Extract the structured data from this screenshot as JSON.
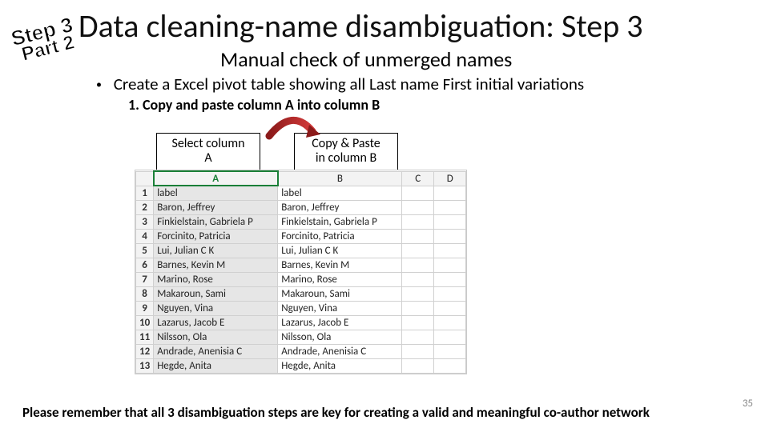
{
  "stamp": {
    "line1": "Step 3",
    "line2": "Part 2"
  },
  "title": "Data cleaning-name disambiguation: Step 3",
  "subtitle": "Manual check of unmerged names",
  "bullet": "Create a Excel pivot table showing all Last name First initial variations",
  "substep": "1. Copy and paste column A into column B",
  "labelA": {
    "l1": "Select column",
    "l2": "A"
  },
  "labelB": {
    "l1": "Copy & Paste",
    "l2": "in column B"
  },
  "sheet": {
    "cols": [
      "A",
      "B",
      "C",
      "D"
    ],
    "rows": [
      {
        "n": "1",
        "a": "label",
        "b": "label"
      },
      {
        "n": "2",
        "a": "Baron, Jeffrey",
        "b": "Baron, Jeffrey"
      },
      {
        "n": "3",
        "a": "Finkielstain, Gabriela P",
        "b": "Finkielstain, Gabriela P"
      },
      {
        "n": "4",
        "a": "Forcinito, Patricia",
        "b": "Forcinito, Patricia"
      },
      {
        "n": "5",
        "a": "Lui, Julian C K",
        "b": "Lui, Julian C K"
      },
      {
        "n": "6",
        "a": "Barnes, Kevin M",
        "b": "Barnes, Kevin M"
      },
      {
        "n": "7",
        "a": "Marino, Rose",
        "b": "Marino, Rose"
      },
      {
        "n": "8",
        "a": "Makaroun, Sami",
        "b": "Makaroun, Sami"
      },
      {
        "n": "9",
        "a": "Nguyen, Vina",
        "b": "Nguyen, Vina"
      },
      {
        "n": "10",
        "a": "Lazarus, Jacob E",
        "b": "Lazarus, Jacob E"
      },
      {
        "n": "11",
        "a": "Nilsson, Ola",
        "b": "Nilsson, Ola"
      },
      {
        "n": "12",
        "a": "Andrade, Anenisia C",
        "b": "Andrade, Anenisia C"
      },
      {
        "n": "13",
        "a": "Hegde, Anita",
        "b": "Hegde, Anita"
      }
    ]
  },
  "footer": "Please remember that all 3 disambiguation steps are key for creating a valid and meaningful co-author network",
  "pagenum": "35"
}
